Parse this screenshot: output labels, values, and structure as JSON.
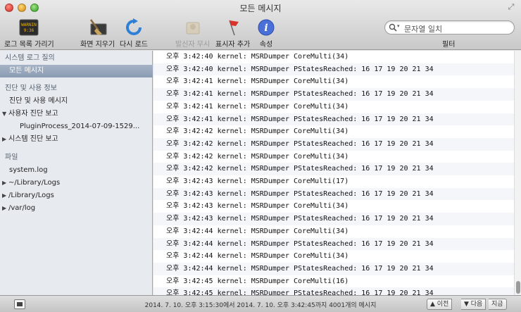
{
  "window": {
    "title": "모든 메시지"
  },
  "toolbar": {
    "log_list_toggle": "로그 목록 가리기",
    "clear_display": "화면 지우기",
    "reload": "다시 로드",
    "ignore_sender": "발신자 무시",
    "insert_marker": "표시자 추가",
    "info": "속성",
    "search_placeholder": "문자열 일치",
    "filter_label": "필터",
    "console_icon_text": "WARNING 9:36"
  },
  "sidebar": {
    "items": [
      {
        "label": "시스템 로그 질의",
        "kind": "heading"
      },
      {
        "label": "모든 메시지",
        "kind": "selected"
      },
      {
        "label": "진단 및 사용 정보",
        "kind": "heading"
      },
      {
        "label": "진단 및 사용 메시지",
        "kind": "item"
      },
      {
        "label": "사용자 진단 보고",
        "kind": "expanded"
      },
      {
        "label": "PluginProcess_2014-07-09-1529...",
        "kind": "child"
      },
      {
        "label": "시스템 진단 보고",
        "kind": "collapsed"
      },
      {
        "label": "파일",
        "kind": "heading"
      },
      {
        "label": "system.log",
        "kind": "item"
      },
      {
        "label": "~/Library/Logs",
        "kind": "collapsed"
      },
      {
        "label": "/Library/Logs",
        "kind": "collapsed"
      },
      {
        "label": "/var/log",
        "kind": "collapsed"
      }
    ]
  },
  "log": {
    "lines": [
      "오후 3:42:40 kernel: MSRDumper CoreMulti(34)",
      "오후 3:42:40 kernel: MSRDumper PStatesReached: 16 17 19 20 21 34",
      "오후 3:42:41 kernel: MSRDumper CoreMulti(34)",
      "오후 3:42:41 kernel: MSRDumper PStatesReached: 16 17 19 20 21 34",
      "오후 3:42:41 kernel: MSRDumper CoreMulti(34)",
      "오후 3:42:41 kernel: MSRDumper PStatesReached: 16 17 19 20 21 34",
      "오후 3:42:42 kernel: MSRDumper CoreMulti(34)",
      "오후 3:42:42 kernel: MSRDumper PStatesReached: 16 17 19 20 21 34",
      "오후 3:42:42 kernel: MSRDumper CoreMulti(34)",
      "오후 3:42:42 kernel: MSRDumper PStatesReached: 16 17 19 20 21 34",
      "오후 3:42:43 kernel: MSRDumper CoreMulti(17)",
      "오후 3:42:43 kernel: MSRDumper PStatesReached: 16 17 19 20 21 34",
      "오후 3:42:43 kernel: MSRDumper CoreMulti(34)",
      "오후 3:42:43 kernel: MSRDumper PStatesReached: 16 17 19 20 21 34",
      "오후 3:42:44 kernel: MSRDumper CoreMulti(34)",
      "오후 3:42:44 kernel: MSRDumper PStatesReached: 16 17 19 20 21 34",
      "오후 3:42:44 kernel: MSRDumper CoreMulti(34)",
      "오후 3:42:44 kernel: MSRDumper PStatesReached: 16 17 19 20 21 34",
      "오후 3:42:45 kernel: MSRDumper CoreMulti(16)",
      "오후 3:42:45 kernel: MSRDumper PStatesReached: 16 17 19 20 21 34"
    ]
  },
  "statusbar": {
    "text": "2014. 7. 10. 오후 3:15:30에서 2014. 7. 10. 오후 3:42:45까지 4001개의 메시지",
    "prev": "▲ 이전",
    "next": "▼ 다음",
    "now": "지금"
  }
}
